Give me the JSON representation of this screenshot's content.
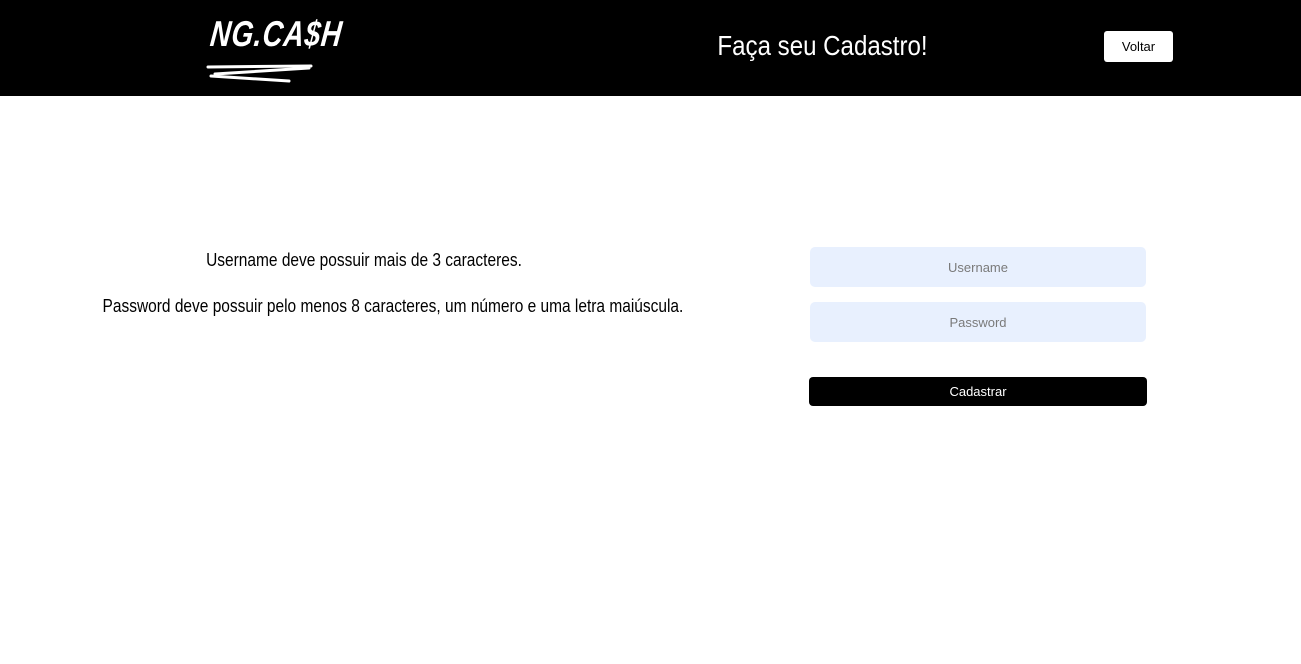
{
  "header": {
    "logo_text": "NG.CA$H",
    "title": "Faça seu Cadastro!",
    "back_label": "Voltar",
    "background_color": "#000000"
  },
  "rules": {
    "username_rule": "Username deve possuir mais de 3 caracteres.",
    "password_rule": "Password deve possuir pelo menos 8 caracteres, um número e uma letra maiúscula."
  },
  "form": {
    "username_placeholder": "Username",
    "username_value": "",
    "password_placeholder": "Password",
    "password_value": "",
    "submit_label": "Cadastrar",
    "input_background": "#e8f0fe"
  }
}
